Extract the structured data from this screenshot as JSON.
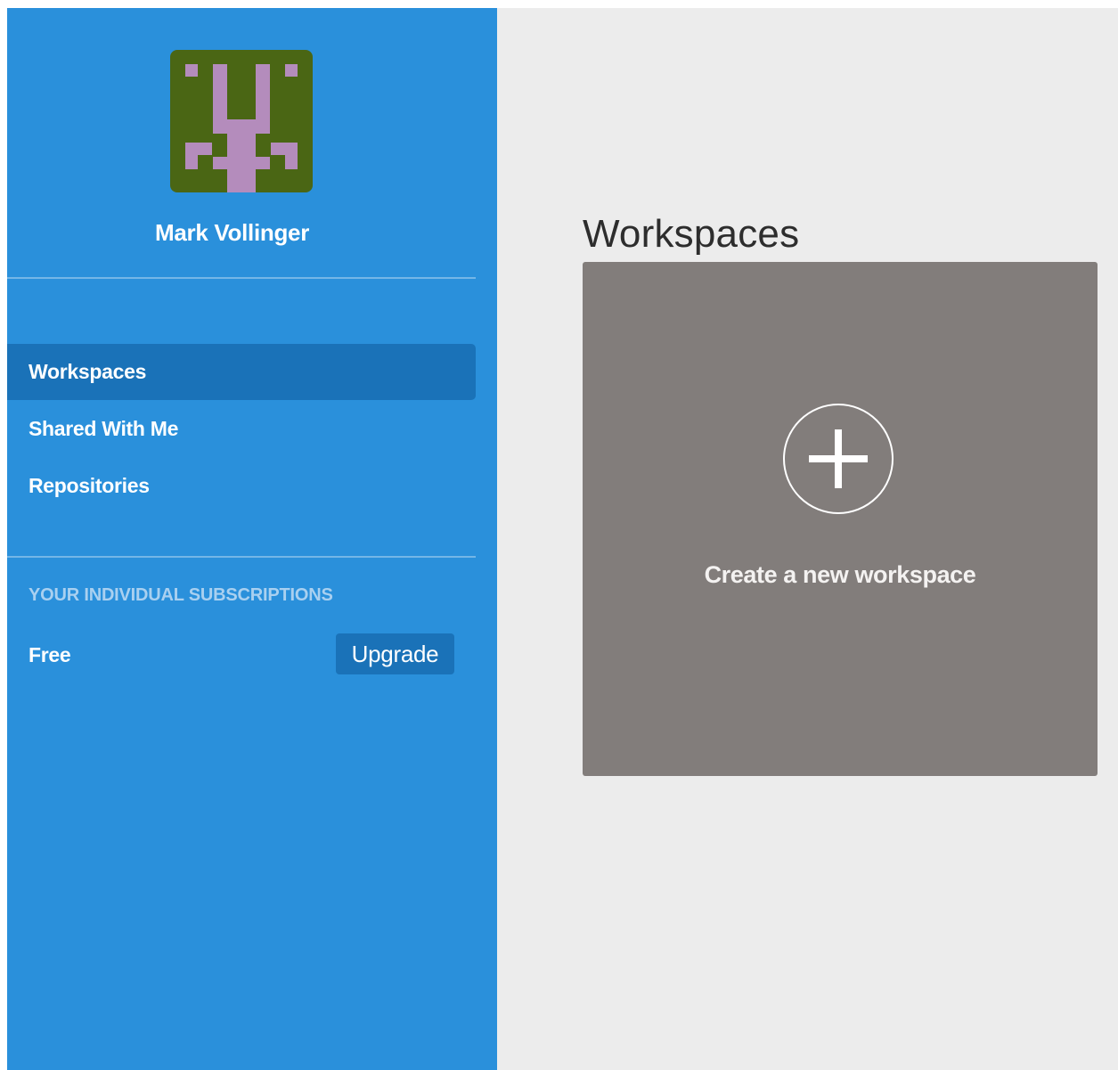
{
  "user": {
    "name": "Mark Vollinger",
    "avatar_colors": {
      "background": "#4a6614",
      "pattern": "#b48cbc"
    }
  },
  "sidebar": {
    "background_color": "#2a90db",
    "active_color": "#1a72b8",
    "items": [
      {
        "label": "Workspaces",
        "active": true
      },
      {
        "label": "Shared With Me",
        "active": false
      },
      {
        "label": "Repositories",
        "active": false
      }
    ],
    "subscriptions": {
      "heading": "YOUR INDIVIDUAL SUBSCRIPTIONS",
      "plan": "Free",
      "upgrade_label": "Upgrade"
    }
  },
  "main": {
    "title": "Workspaces",
    "create_card": {
      "label": "Create a new workspace",
      "icon": "plus-circle-icon",
      "color": "#827d7b"
    }
  }
}
